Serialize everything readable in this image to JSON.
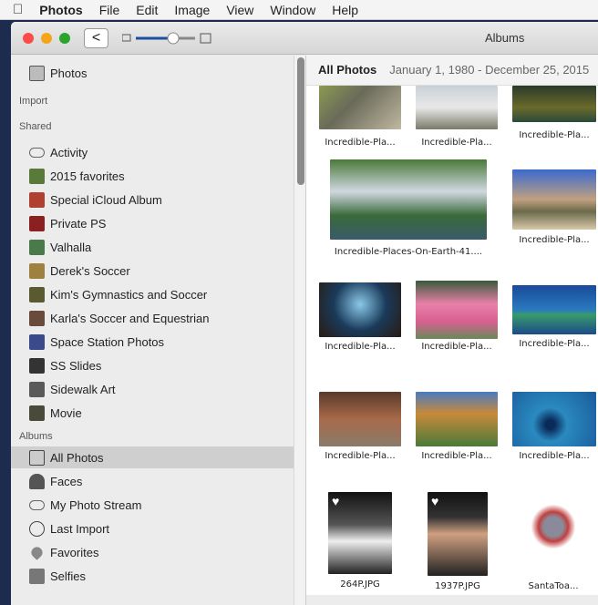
{
  "menubar": {
    "apple": "",
    "items": [
      "Photos",
      "File",
      "Edit",
      "Image",
      "View",
      "Window",
      "Help"
    ]
  },
  "window": {
    "title": "Albums",
    "back": "<"
  },
  "sidebar": {
    "photos": "Photos",
    "import": "Import",
    "shared_header": "Shared",
    "shared": [
      "Activity",
      "2015 favorites",
      "Special iCloud Album",
      "Private PS",
      "Valhalla",
      "Derek's Soccer",
      "Kim's Gymnastics and Soccer",
      "Karla's Soccer and Equestrian",
      "Space Station Photos",
      "SS Slides",
      "Sidewalk Art",
      "Movie"
    ],
    "albums_header": "Albums",
    "albums": [
      "All Photos",
      "Faces",
      "My Photo Stream",
      "Last Import",
      "Favorites",
      "Selfies"
    ]
  },
  "content": {
    "title": "All Photos",
    "date_range": "January 1, 1980 - December 25, 2015",
    "tiles": [
      "Incredible-Pla...",
      "Incredible-Pla...",
      "Incredible-Pla...",
      "Incredible-Places-On-Earth-41....",
      "Incredible-Pla...",
      "Incredible-Pla...",
      "Incredible-Pla...",
      "Incredible-Pla...",
      "Incredible-Pla...",
      "Incredible-Pla...",
      "Incredible-Pla...",
      "264P.JPG",
      "1937P.JPG",
      "SantaToa..."
    ]
  },
  "colors": {
    "selection": "#cfcfcf",
    "slider": "#1d4f9c"
  }
}
